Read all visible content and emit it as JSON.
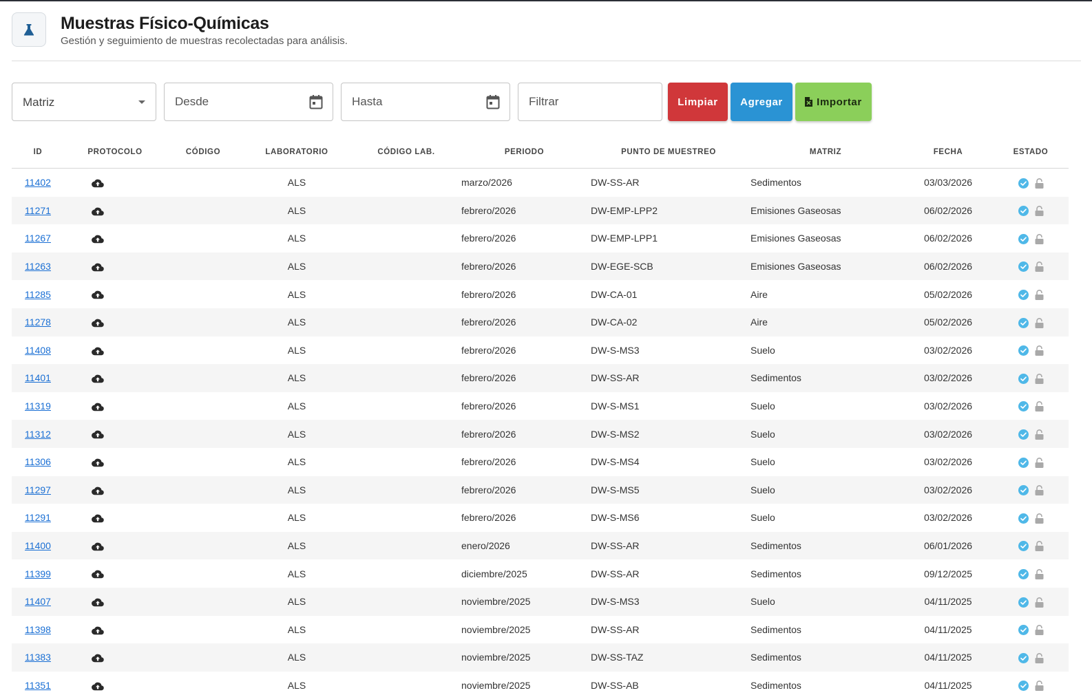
{
  "header": {
    "title": "Muestras Físico-Químicas",
    "subtitle": "Gestión y seguimiento de muestras recolectadas para análisis.",
    "logo_icon": "flask-icon"
  },
  "filters": {
    "matriz_label": "Matriz",
    "desde_label": "Desde",
    "hasta_label": "Hasta",
    "filtrar_placeholder": "Filtrar"
  },
  "buttons": {
    "limpiar": "Limpiar",
    "agregar": "Agregar",
    "importar": "Importar"
  },
  "colors": {
    "limpiar": "#d0373a",
    "agregar": "#2a93d4",
    "importar": "#8bcf5a",
    "link": "#1a6fd4",
    "check": "#4fb8e8"
  },
  "table": {
    "columns": [
      "ID",
      "PROTOCOLO",
      "CÓDIGO",
      "LABORATORIO",
      "CÓDIGO LAB.",
      "PERIODO",
      "PUNTO DE MUESTREO",
      "MATRIZ",
      "FECHA",
      "ESTADO"
    ],
    "rows": [
      {
        "id": "11402",
        "laboratorio": "ALS",
        "periodo": "marzo/2026",
        "punto": "DW-SS-AR",
        "matriz": "Sedimentos",
        "fecha": "03/03/2026"
      },
      {
        "id": "11271",
        "laboratorio": "ALS",
        "periodo": "febrero/2026",
        "punto": "DW-EMP-LPP2",
        "matriz": "Emisiones Gaseosas",
        "fecha": "06/02/2026"
      },
      {
        "id": "11267",
        "laboratorio": "ALS",
        "periodo": "febrero/2026",
        "punto": "DW-EMP-LPP1",
        "matriz": "Emisiones Gaseosas",
        "fecha": "06/02/2026"
      },
      {
        "id": "11263",
        "laboratorio": "ALS",
        "periodo": "febrero/2026",
        "punto": "DW-EGE-SCB",
        "matriz": "Emisiones Gaseosas",
        "fecha": "06/02/2026"
      },
      {
        "id": "11285",
        "laboratorio": "ALS",
        "periodo": "febrero/2026",
        "punto": "DW-CA-01",
        "matriz": "Aire",
        "fecha": "05/02/2026"
      },
      {
        "id": "11278",
        "laboratorio": "ALS",
        "periodo": "febrero/2026",
        "punto": "DW-CA-02",
        "matriz": "Aire",
        "fecha": "05/02/2026"
      },
      {
        "id": "11408",
        "laboratorio": "ALS",
        "periodo": "febrero/2026",
        "punto": "DW-S-MS3",
        "matriz": "Suelo",
        "fecha": "03/02/2026"
      },
      {
        "id": "11401",
        "laboratorio": "ALS",
        "periodo": "febrero/2026",
        "punto": "DW-SS-AR",
        "matriz": "Sedimentos",
        "fecha": "03/02/2026"
      },
      {
        "id": "11319",
        "laboratorio": "ALS",
        "periodo": "febrero/2026",
        "punto": "DW-S-MS1",
        "matriz": "Suelo",
        "fecha": "03/02/2026"
      },
      {
        "id": "11312",
        "laboratorio": "ALS",
        "periodo": "febrero/2026",
        "punto": "DW-S-MS2",
        "matriz": "Suelo",
        "fecha": "03/02/2026"
      },
      {
        "id": "11306",
        "laboratorio": "ALS",
        "periodo": "febrero/2026",
        "punto": "DW-S-MS4",
        "matriz": "Suelo",
        "fecha": "03/02/2026"
      },
      {
        "id": "11297",
        "laboratorio": "ALS",
        "periodo": "febrero/2026",
        "punto": "DW-S-MS5",
        "matriz": "Suelo",
        "fecha": "03/02/2026"
      },
      {
        "id": "11291",
        "laboratorio": "ALS",
        "periodo": "febrero/2026",
        "punto": "DW-S-MS6",
        "matriz": "Suelo",
        "fecha": "03/02/2026"
      },
      {
        "id": "11400",
        "laboratorio": "ALS",
        "periodo": "enero/2026",
        "punto": "DW-SS-AR",
        "matriz": "Sedimentos",
        "fecha": "06/01/2026"
      },
      {
        "id": "11399",
        "laboratorio": "ALS",
        "periodo": "diciembre/2025",
        "punto": "DW-SS-AR",
        "matriz": "Sedimentos",
        "fecha": "09/12/2025"
      },
      {
        "id": "11407",
        "laboratorio": "ALS",
        "periodo": "noviembre/2025",
        "punto": "DW-S-MS3",
        "matriz": "Suelo",
        "fecha": "04/11/2025"
      },
      {
        "id": "11398",
        "laboratorio": "ALS",
        "periodo": "noviembre/2025",
        "punto": "DW-SS-AR",
        "matriz": "Sedimentos",
        "fecha": "04/11/2025"
      },
      {
        "id": "11383",
        "laboratorio": "ALS",
        "periodo": "noviembre/2025",
        "punto": "DW-SS-TAZ",
        "matriz": "Sedimentos",
        "fecha": "04/11/2025"
      },
      {
        "id": "11351",
        "laboratorio": "ALS",
        "periodo": "noviembre/2025",
        "punto": "DW-SS-AB",
        "matriz": "Sedimentos",
        "fecha": "04/11/2025"
      }
    ]
  }
}
